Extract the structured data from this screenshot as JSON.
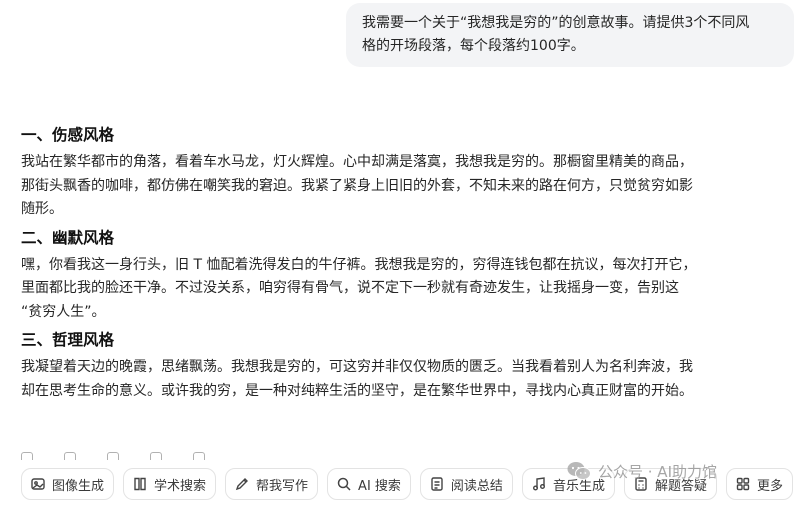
{
  "user_message": {
    "line1": "我需要一个关于“我想我是穷的”的创意故事。请提供3个不同风",
    "line2": "格的开场段落，每个段落约100字。"
  },
  "sections": [
    {
      "heading": "一、伤感风格",
      "lines": [
        "我站在繁华都市的角落，看着车水马龙，灯火辉煌。心中却满是落寞，我想我是穷的。那橱窗里精美的商品，",
        "那街头飘香的咖啡，都仿佛在嘲笑我的窘迫。我紧了紧身上旧旧的外套，不知未来的路在何方，只觉贫穷如影",
        "随形。"
      ]
    },
    {
      "heading": "二、幽默风格",
      "lines": [
        "嘿，你看我这一身行头，旧 T 恤配着洗得发白的牛仔裤。我想我是穷的，穷得连钱包都在抗议，每次打开它，",
        "里面都比我的脸还干净。不过没关系，咱穷得有骨气，说不定下一秒就有奇迹发生，让我摇身一变，告别这",
        "“贫穷人生”。"
      ]
    },
    {
      "heading": "三、哲理风格",
      "lines": [
        "我凝望着天边的晚霞，思绪飘荡。我想我是穷的，可这穷并非仅仅物质的匮乏。当我看着别人为名利奔波，我",
        "却在思考生命的意义。或许我的穷，是一种对纯粹生活的坚守，是在繁华世界中，寻找内心真正财富的开始。"
      ]
    }
  ],
  "toolbar": {
    "items": [
      {
        "label": "图像生成",
        "icon": "image-icon"
      },
      {
        "label": "学术搜索",
        "icon": "book-icon"
      },
      {
        "label": "帮我写作",
        "icon": "pen-icon"
      },
      {
        "label": "AI 搜索",
        "icon": "search-icon"
      },
      {
        "label": "阅读总结",
        "icon": "document-icon"
      },
      {
        "label": "音乐生成",
        "icon": "music-note-icon"
      },
      {
        "label": "解题答疑",
        "icon": "calculator-icon"
      },
      {
        "label": "更多",
        "icon": "grid-icon"
      }
    ]
  },
  "watermark": {
    "text": "公众号 · AI助力馆",
    "icon": "wechat-icon"
  }
}
